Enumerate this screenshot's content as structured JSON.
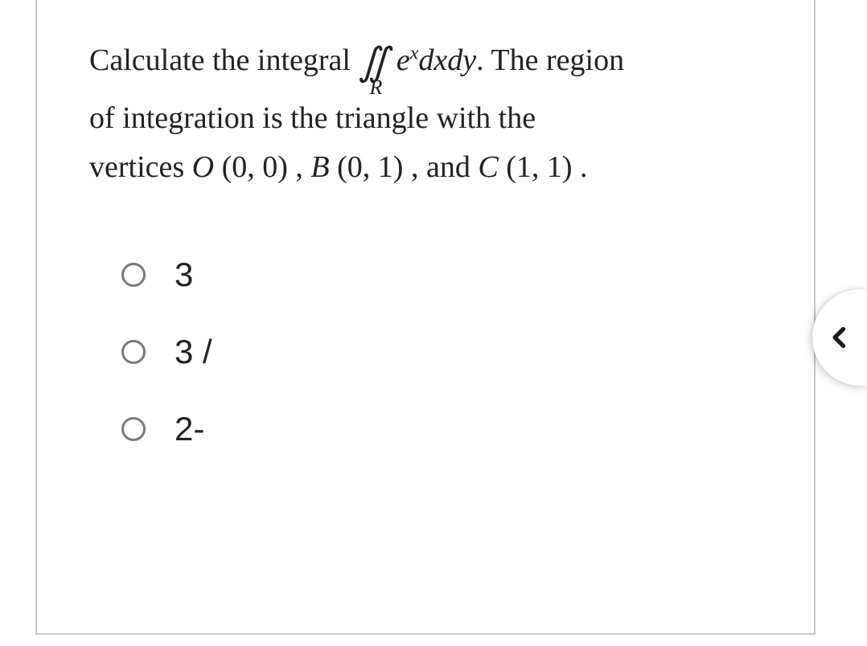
{
  "question": {
    "part1": "Calculate the integral ",
    "integral_region": "R",
    "integrand_base": "e",
    "integrand_exp": "x",
    "integrand_diff": "dxdy",
    "part2": ". The region",
    "line2a": "of integration is the triangle with the",
    "line3a": "vertices ",
    "vertexO": "O",
    "vertexO_coords": " (0, 0)",
    "sep1": " , ",
    "vertexB": "B",
    "vertexB_coords": " (0, 1)",
    "sep2": " , and ",
    "vertexC": "C",
    "vertexC_coords": " (1, 1)",
    "end": " ."
  },
  "options": [
    {
      "label": "3"
    },
    {
      "label": "3 / "
    },
    {
      "label": "2- "
    }
  ]
}
